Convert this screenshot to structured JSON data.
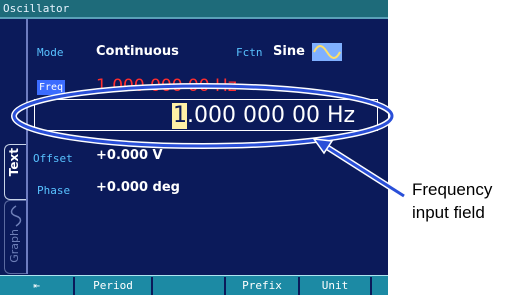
{
  "window": {
    "title": "Oscillator"
  },
  "params": {
    "mode_label": "Mode",
    "mode_value": "Continuous",
    "fctn_label": "Fctn",
    "fctn_value": "Sine",
    "freq_label": "Freq",
    "freq_value": "1.000 000 00 Hz",
    "offset_label": "Offset",
    "offset_value": "+0.000 V",
    "phase_label": "Phase",
    "phase_value": "+0.000 deg"
  },
  "input": {
    "cursor_digit": "1",
    "rest": ".000 000 00 Hz"
  },
  "tabs": {
    "text": "Text",
    "graph": "Graph"
  },
  "softkeys": {
    "back": "⇤",
    "period": "Period",
    "blank1": "",
    "prefix": "Prefix",
    "unit": "Unit"
  },
  "annotation": {
    "line1": "Frequency",
    "line2": "input field"
  },
  "colors": {
    "screen_bg": "#0b1a5a",
    "label": "#58c2ff",
    "freq_red": "#ff2e2e",
    "softkey_bar": "#1c8aa4",
    "callout": "#2a4fd8"
  }
}
